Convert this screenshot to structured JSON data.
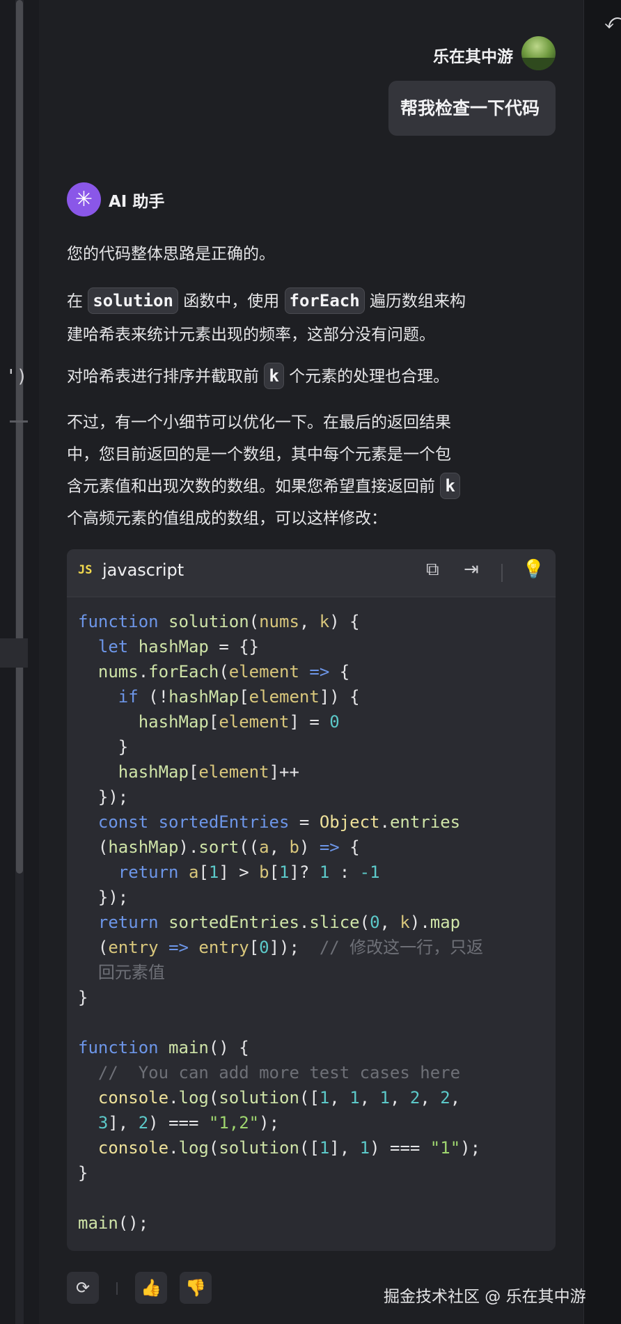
{
  "user": {
    "name": "乐在其中游",
    "message": "帮我检查一下代码"
  },
  "assistant": {
    "name": "AI 助手",
    "avatar_icon": "sparkle-icon",
    "paragraphs": {
      "p1": "您的代码整体思路是正确的。",
      "p2_a": "在",
      "p2_code1": "solution",
      "p2_b": "函数中，使用",
      "p2_code2": "forEach",
      "p2_c": "遍历数组来构",
      "p2_d": "建哈希表来统计元素出现的频率，这部分没有问题。",
      "p3_a": "对哈希表进行排序并截取前",
      "p3_code": "k",
      "p3_b": "个元素的处理也合理。",
      "p4_l1": "不过，有一个小细节可以优化一下。在最后的返回结果",
      "p4_l2": "中，您目前返回的是一个数组，其中每个元素是一个包",
      "p4_l3": "含元素值和出现次数的数组。如果您希望直接返回前",
      "p4_code": "k",
      "p4_l4": "个高频元素的值组成的数组，可以这样修改："
    }
  },
  "code_block": {
    "badge": "JS",
    "language": "javascript",
    "icons": [
      "copy-icon",
      "insert-icon",
      "lightbulb-icon"
    ]
  },
  "actions": [
    "refresh-icon",
    "thumbs-up-icon",
    "thumbs-down-icon"
  ],
  "watermark": "掘金技术社区 @ 乐在其中游",
  "colors": {
    "background": "#1e1f23",
    "code_bg": "#2a2b31",
    "accent": "#8a57e8",
    "keyword": "#6d96e8",
    "number": "#5cc9c9",
    "string": "#9fd66f"
  }
}
